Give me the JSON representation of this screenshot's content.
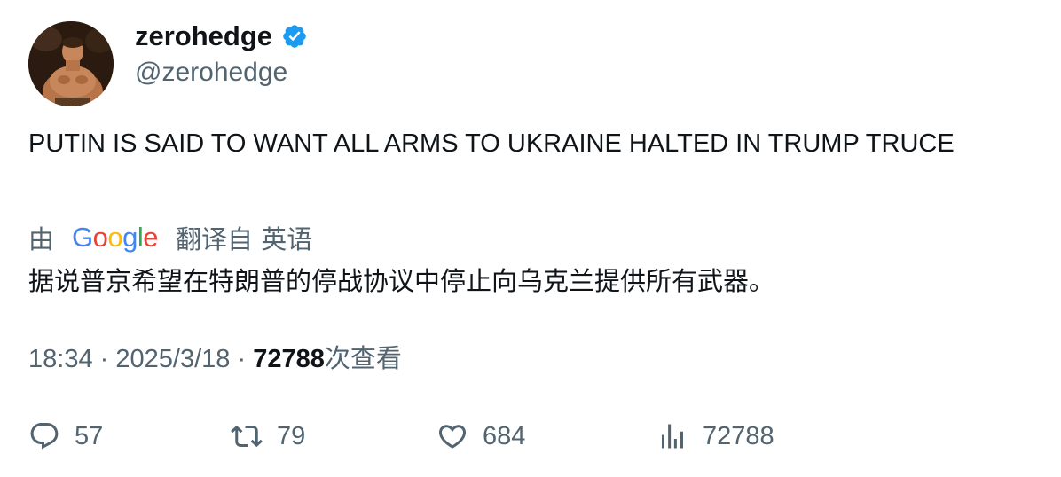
{
  "author": {
    "display_name": "zerohedge",
    "handle": "@zerohedge",
    "verified": true,
    "avatar_icon": "avatar-image"
  },
  "tweet": {
    "text": "PUTIN IS SAID TO WANT ALL ARMS TO UKRAINE HALTED IN TRUMP TRUCE"
  },
  "translation": {
    "prefix": "由",
    "provider_letters": [
      "G",
      "o",
      "o",
      "g",
      "l",
      "e"
    ],
    "suffix": "翻译自 英语",
    "text": "据说普京希望在特朗普的停战协议中停止向乌克兰提供所有武器。"
  },
  "meta": {
    "time": "18:34",
    "separator": "·",
    "date": "2025/3/18",
    "views_count": "72788",
    "views_label": "次查看"
  },
  "actions": {
    "replies": "57",
    "retweets": "79",
    "likes": "684",
    "views": "72788"
  },
  "colors": {
    "verified_blue": "#1D9BF0",
    "secondary_text": "#536471",
    "primary_text": "#0f1419"
  }
}
